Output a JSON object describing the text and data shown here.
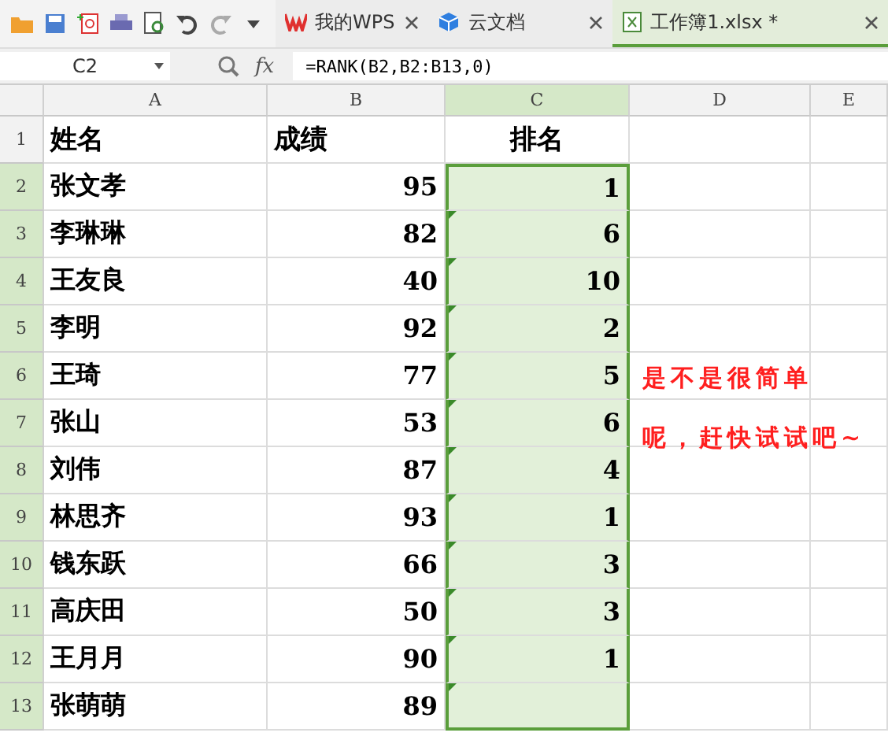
{
  "tabs": [
    {
      "label": "我的WPS",
      "kind": "wps",
      "selected": false
    },
    {
      "label": "云文档",
      "kind": "cloud",
      "selected": false
    },
    {
      "label": "工作簿1.xlsx *",
      "kind": "sheet",
      "selected": true
    }
  ],
  "formula_bar": {
    "name_box": "C2",
    "fx": "fx",
    "formula": "=RANK(B2,B2:B13,0)"
  },
  "columns": [
    {
      "label": "A",
      "selected": false
    },
    {
      "label": "B",
      "selected": false
    },
    {
      "label": "C",
      "selected": true
    },
    {
      "label": "D",
      "selected": false
    },
    {
      "label": "E",
      "selected": false
    }
  ],
  "rows": [
    {
      "number": "1",
      "selected": false,
      "flagged": false,
      "cells": [
        "姓名",
        "成绩",
        "排名"
      ]
    },
    {
      "number": "2",
      "selected": true,
      "flagged": false,
      "cells": [
        "张文孝",
        "95",
        "1"
      ]
    },
    {
      "number": "3",
      "selected": true,
      "flagged": true,
      "cells": [
        "李琳琳",
        "82",
        "6"
      ]
    },
    {
      "number": "4",
      "selected": true,
      "flagged": true,
      "cells": [
        "王友良",
        "40",
        "10"
      ]
    },
    {
      "number": "5",
      "selected": true,
      "flagged": true,
      "cells": [
        "李明",
        "92",
        "2"
      ]
    },
    {
      "number": "6",
      "selected": true,
      "flagged": true,
      "cells": [
        "王琦",
        "77",
        "5"
      ]
    },
    {
      "number": "7",
      "selected": true,
      "flagged": true,
      "cells": [
        "张山",
        "53",
        "6"
      ]
    },
    {
      "number": "8",
      "selected": true,
      "flagged": true,
      "cells": [
        "刘伟",
        "87",
        "4"
      ]
    },
    {
      "number": "9",
      "selected": true,
      "flagged": true,
      "cells": [
        "林思齐",
        "93",
        "1"
      ]
    },
    {
      "number": "10",
      "selected": true,
      "flagged": true,
      "cells": [
        "钱东跃",
        "66",
        "3"
      ]
    },
    {
      "number": "11",
      "selected": true,
      "flagged": true,
      "cells": [
        "高庆田",
        "50",
        "3"
      ]
    },
    {
      "number": "12",
      "selected": true,
      "flagged": true,
      "cells": [
        "王月月",
        "90",
        "1"
      ]
    },
    {
      "number": "13",
      "selected": true,
      "flagged": true,
      "cells": [
        "张萌萌",
        "89",
        ""
      ]
    }
  ],
  "note": [
    "是不是很简单",
    "呢，赶快试试吧~"
  ]
}
